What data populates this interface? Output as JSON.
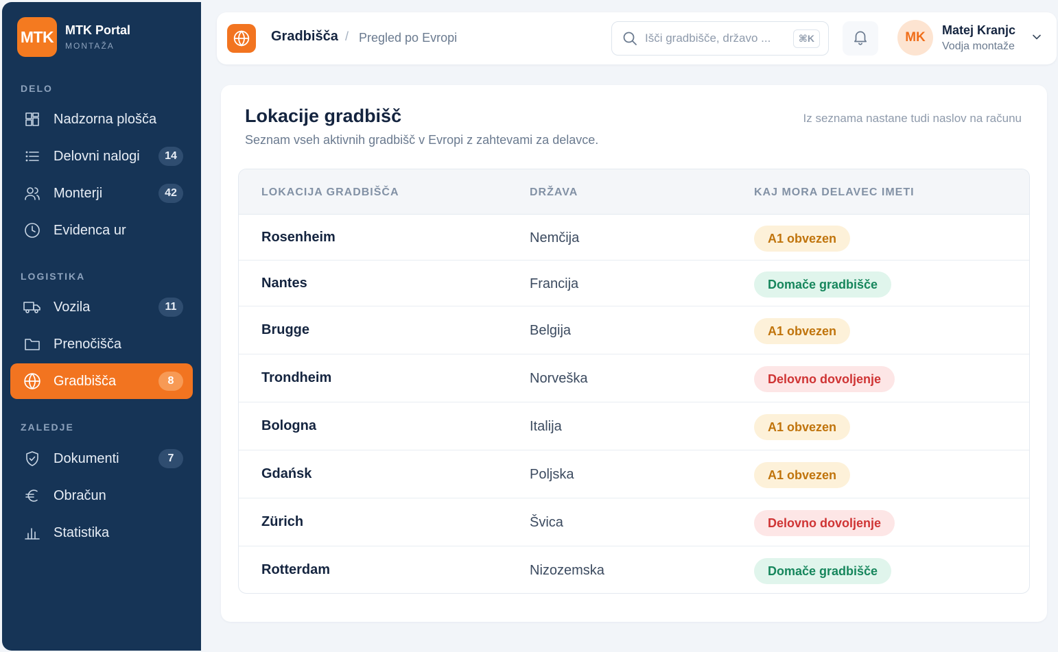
{
  "colors": {
    "sidebar_bg": "#163456",
    "accent": "#f27420",
    "badge_amber_bg": "#fdf1d9",
    "badge_amber_text": "#c0740c",
    "badge_green_bg": "#e0f5ec",
    "badge_green_text": "#16865c",
    "badge_red_bg": "#fde6e6",
    "badge_red_text": "#cf3434"
  },
  "brand": {
    "logo": "MTK",
    "name": "MTK Portal",
    "sub": "MONTAŽA"
  },
  "sidebar": {
    "sections": [
      {
        "label": "DELO",
        "items": [
          {
            "label": "Nadzorna plošča",
            "icon": "dashboard-icon"
          },
          {
            "label": "Delovni nalogi",
            "icon": "list-icon",
            "count": "14"
          },
          {
            "label": "Monterji",
            "icon": "users-icon",
            "count": "42"
          },
          {
            "label": "Evidenca ur",
            "icon": "clock-icon"
          }
        ]
      },
      {
        "label": "LOGISTIKA",
        "items": [
          {
            "label": "Vozila",
            "icon": "truck-icon",
            "count": "11"
          },
          {
            "label": "Prenočišča",
            "icon": "folder-icon"
          },
          {
            "label": "Gradbišča",
            "icon": "globe-icon",
            "count": "8",
            "active": true
          }
        ]
      },
      {
        "label": "ZALEDJE",
        "items": [
          {
            "label": "Dokumenti",
            "icon": "shield-icon",
            "count": "7"
          },
          {
            "label": "Obračun",
            "icon": "euro-icon"
          },
          {
            "label": "Statistika",
            "icon": "bar-chart-icon"
          }
        ]
      }
    ]
  },
  "header": {
    "title": "Gradbišča",
    "separator": "/",
    "subtitle": "Pregled po Evropi",
    "search_placeholder": "Išči gradbišče, državo ...",
    "shortcut": "⌘K",
    "user": {
      "initials": "MK",
      "name": "Matej Kranjc",
      "role": "Vodja montaže"
    }
  },
  "card": {
    "title": "Lokacije gradbišč",
    "subtitle": "Seznam vseh aktivnih gradbišč v Evropi z zahtevami za delavce.",
    "note": "Iz seznama nastane tudi naslov na računu"
  },
  "table": {
    "columns": [
      "LOKACIJA GRADBIŠČA",
      "DRŽAVA",
      "KAJ MORA DELAVEC IMETI"
    ],
    "rows": [
      {
        "location": "Rosenheim",
        "country": "Nemčija",
        "requirement": "A1 obvezen",
        "kind": "amber"
      },
      {
        "location": "Nantes",
        "country": "Francija",
        "requirement": "Domače gradbišče",
        "kind": "green"
      },
      {
        "location": "Brugge",
        "country": "Belgija",
        "requirement": "A1 obvezen",
        "kind": "amber"
      },
      {
        "location": "Trondheim",
        "country": "Norveška",
        "requirement": "Delovno dovoljenje",
        "kind": "red"
      },
      {
        "location": "Bologna",
        "country": "Italija",
        "requirement": "A1 obvezen",
        "kind": "amber"
      },
      {
        "location": "Gdańsk",
        "country": "Poljska",
        "requirement": "A1 obvezen",
        "kind": "amber"
      },
      {
        "location": "Zürich",
        "country": "Švica",
        "requirement": "Delovno dovoljenje",
        "kind": "red"
      },
      {
        "location": "Rotterdam",
        "country": "Nizozemska",
        "requirement": "Domače gradbišče",
        "kind": "green"
      }
    ]
  }
}
